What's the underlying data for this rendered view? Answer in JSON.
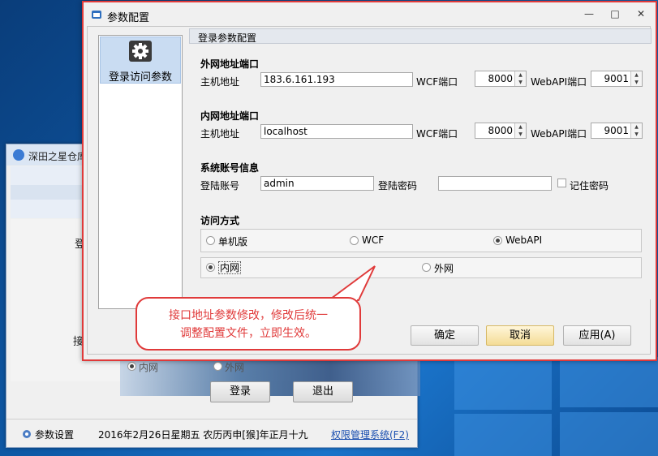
{
  "colors": {
    "accent_red": "#e03a3a",
    "selection_blue": "#c9dcf2",
    "dialog_bg": "#f0f0f0"
  },
  "background_window": {
    "title": "深田之星仓库",
    "label_partial_1": "登",
    "label_partial_2": "接",
    "radio_inner": "内网",
    "radio_outer": "外网",
    "login_button": "登录",
    "exit_button": "退出",
    "status": {
      "settings_label": "参数设置",
      "date_text": "2016年2月26日星期五 农历丙申[猴]年正月十九",
      "admin_link": "权限管理系统(F2)"
    }
  },
  "dialog": {
    "title": "参数配置",
    "window_controls": [
      "—",
      "□",
      "✕"
    ],
    "nav_items": [
      {
        "label": "登录访问参数",
        "icon": "gear-icon"
      }
    ],
    "panel_header": "登录参数配置",
    "external": {
      "section_title": "外网地址端口",
      "host_label": "主机地址",
      "host_value": "183.6.161.193",
      "wcf_label": "WCF端口",
      "wcf_value": "8000",
      "webapi_label": "WebAPI端口",
      "webapi_value": "9001"
    },
    "internal": {
      "section_title": "内网地址端口",
      "host_label": "主机地址",
      "host_value": "localhost",
      "wcf_label": "WCF端口",
      "wcf_value": "8000",
      "webapi_label": "WebAPI端口",
      "webapi_value": "9001"
    },
    "account": {
      "section_title": "系统账号信息",
      "user_label": "登陆账号",
      "user_value": "admin",
      "password_label": "登陆密码",
      "password_value": "",
      "remember_label": "记住密码"
    },
    "access": {
      "section_title": "访问方式",
      "mode_options": [
        "单机版",
        "WCF",
        "WebAPI"
      ],
      "mode_selected": "WebAPI",
      "network_options": [
        "内网",
        "外网"
      ],
      "network_selected": "内网"
    },
    "buttons": {
      "ok": "确定",
      "cancel": "取消",
      "apply": "应用(A)"
    }
  },
  "callout": {
    "line1": "接口地址参数修改，修改后统一",
    "line2": "调整配置文件，立即生效。"
  }
}
